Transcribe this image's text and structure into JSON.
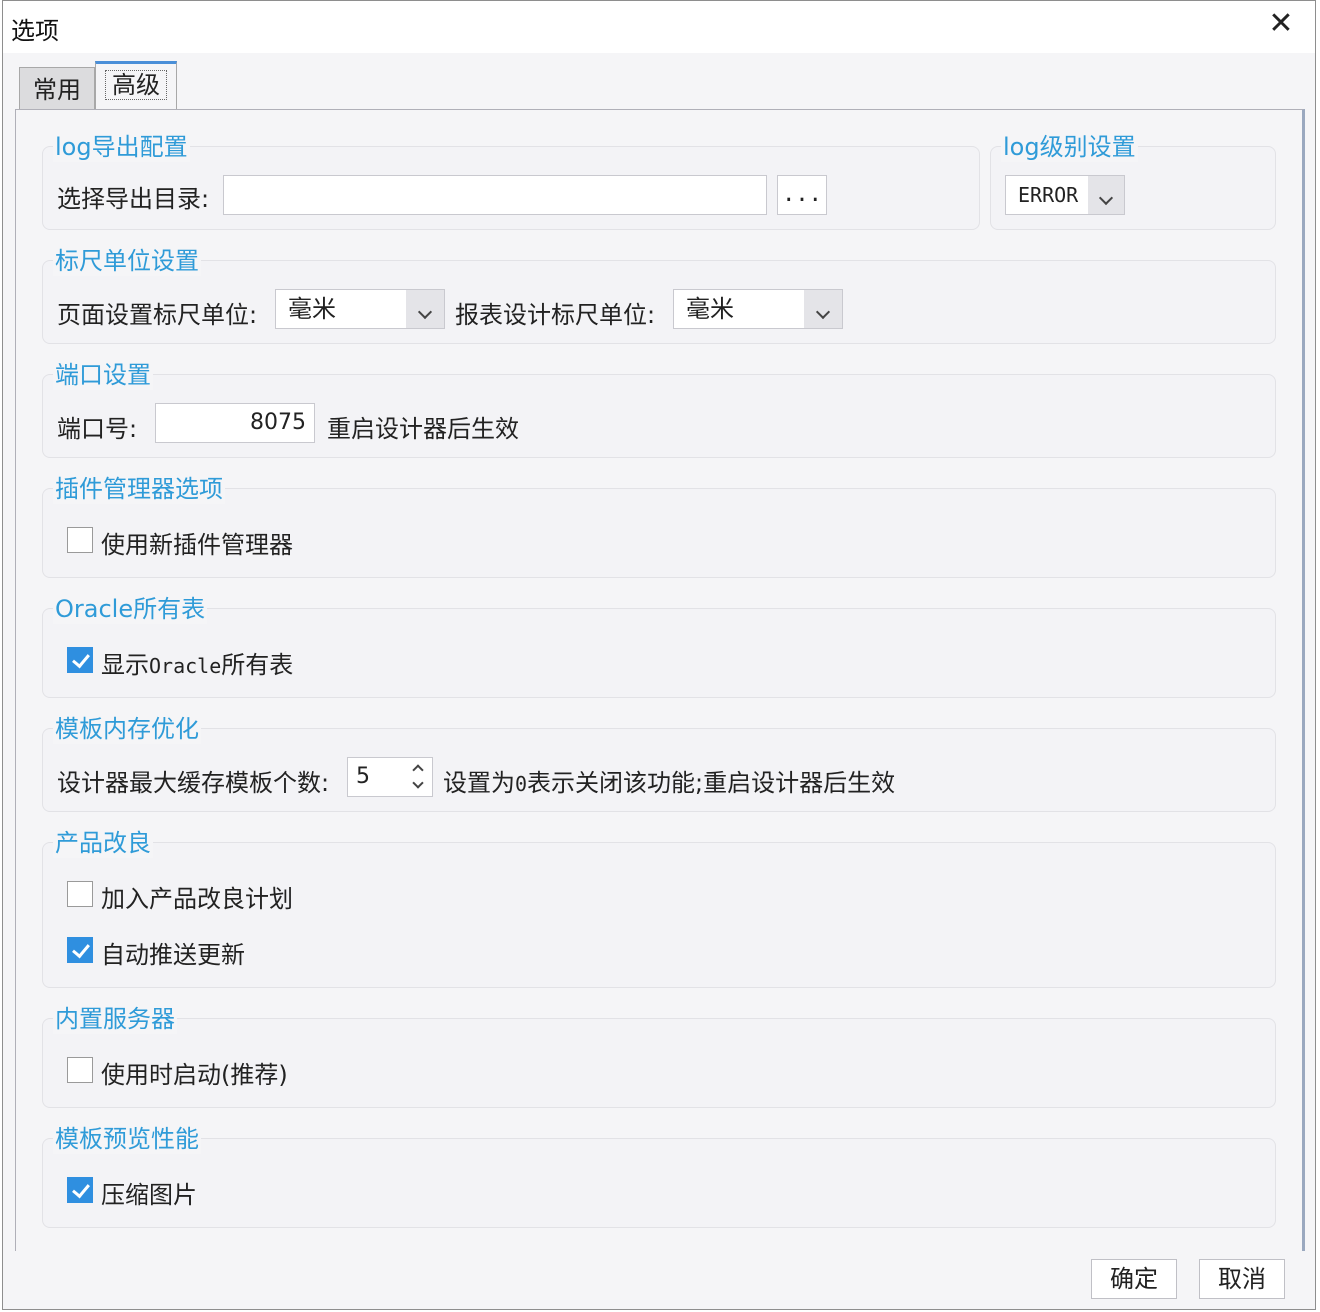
{
  "window": {
    "title": "选项",
    "close_symbol": "✕"
  },
  "tabs": [
    {
      "label": "常用"
    },
    {
      "label": "高级"
    }
  ],
  "log_export": {
    "legend": "log导出配置",
    "dir_label": "选择导出目录:",
    "dir_value": "",
    "browse_label": "..."
  },
  "log_level": {
    "legend": "log级别设置",
    "value": "ERROR"
  },
  "ruler": {
    "legend": "标尺单位设置",
    "page_label": "页面设置标尺单位:",
    "page_value": "毫米",
    "report_label": "报表设计标尺单位:",
    "report_value": "毫米"
  },
  "port": {
    "legend": "端口设置",
    "label": "端口号:",
    "value": "8075",
    "note": "重启设计器后生效"
  },
  "plugin": {
    "legend": "插件管理器选项",
    "checkbox_label": "使用新插件管理器",
    "checked": false
  },
  "oracle": {
    "legend": "Oracle所有表",
    "checkbox_label_prefix": "显示",
    "checkbox_label_mono": "Oracle",
    "checkbox_label_suffix": "所有表",
    "checked": true
  },
  "template_memory": {
    "legend": "模板内存优化",
    "label": "设计器最大缓存模板个数:",
    "value": "5",
    "note_prefix": "设置为",
    "note_zero": "0",
    "note_suffix": "表示关闭该功能;重启设计器后生效"
  },
  "improvement": {
    "legend": "产品改良",
    "join_label": "加入产品改良计划",
    "join_checked": false,
    "push_label": "自动推送更新",
    "push_checked": true
  },
  "server": {
    "legend": "内置服务器",
    "checkbox_label": "使用时启动(推荐)",
    "checked": false
  },
  "preview": {
    "legend": "模板预览性能",
    "checkbox_label": "压缩图片",
    "checked": true
  },
  "footer": {
    "ok_label": "确定",
    "cancel_label": "取消"
  },
  "colors": {
    "accent": "#2f9bd8",
    "checkbox": "#2f8fe0"
  }
}
